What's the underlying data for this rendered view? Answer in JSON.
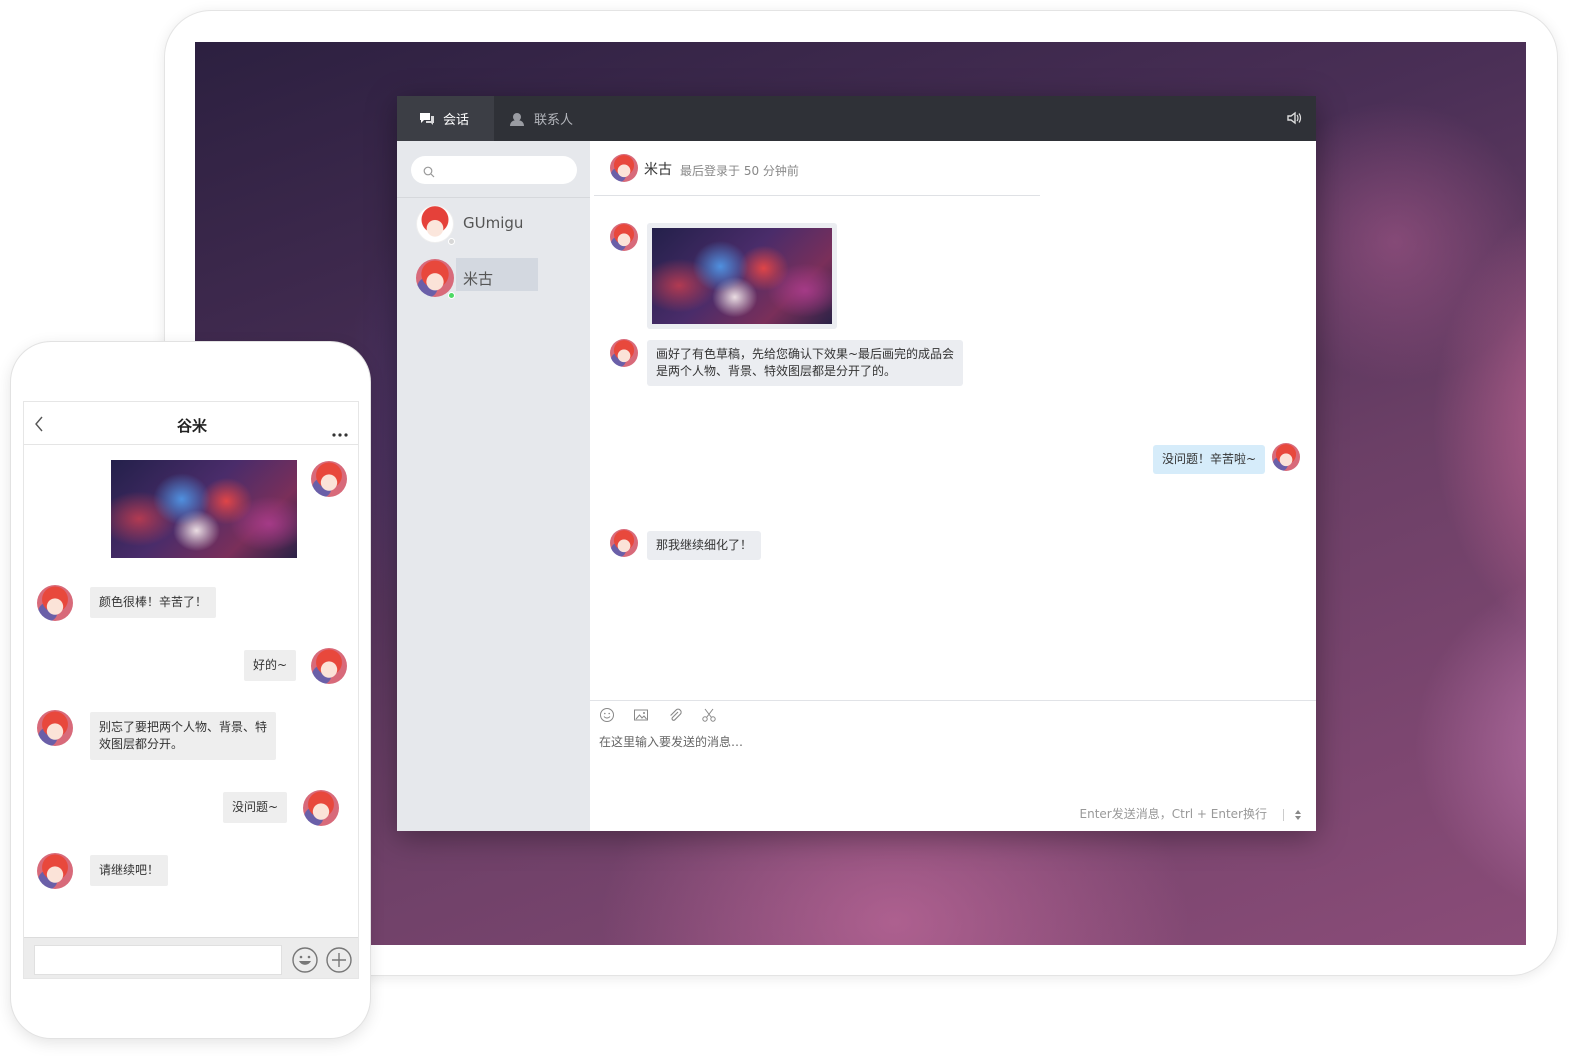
{
  "desktop": {
    "tabs": [
      {
        "label": "会话",
        "icon": "chat-bubble-icon",
        "active": true
      },
      {
        "label": "联系人",
        "icon": "contacts-icon",
        "active": false
      }
    ],
    "speaker_icon": "speaker-icon",
    "sidebar": {
      "search_placeholder": "",
      "contacts": [
        {
          "name": "GUmigu",
          "online": false
        },
        {
          "name": "米古",
          "online": true,
          "selected": true
        }
      ]
    },
    "chat": {
      "contact_name": "米古",
      "status": "最后登录于  50 分钟前",
      "messages": [
        {
          "from": "them",
          "type": "image"
        },
        {
          "from": "them",
          "type": "text",
          "lines": [
            "画好了有色草稿，先给您确认下效果~最后画完的成品会",
            "是两个人物、背景、特效图层都是分开了的。"
          ]
        },
        {
          "from": "me",
          "type": "text",
          "text": "没问题！辛苦啦~"
        },
        {
          "from": "them",
          "type": "text",
          "text": "那我继续细化了！"
        }
      ],
      "tools": [
        "emoji-icon",
        "image-icon",
        "attachment-icon",
        "scissors-icon"
      ],
      "input_placeholder": "在这里输入要发送的消息…",
      "send_hint": "Enter发送消息，Ctrl + Enter换行"
    }
  },
  "phone": {
    "title": "谷米",
    "messages": [
      {
        "from": "me",
        "type": "image"
      },
      {
        "from": "them",
        "type": "text",
        "text": "颜色很棒！辛苦了！"
      },
      {
        "from": "me",
        "type": "text",
        "text": "好的~"
      },
      {
        "from": "them",
        "type": "text",
        "lines": [
          "别忘了要把两个人物、背景、特",
          "效图层都分开。"
        ]
      },
      {
        "from": "me",
        "type": "text",
        "text": "没问题~"
      },
      {
        "from": "them",
        "type": "text",
        "text": "请继续吧！"
      }
    ]
  },
  "colors": {
    "titlebar": "#2f3137",
    "sidebar": "#e6e8ec",
    "bubble_them": "#ebedf1",
    "bubble_me": "#d6ecfa",
    "online": "#4cd964"
  }
}
